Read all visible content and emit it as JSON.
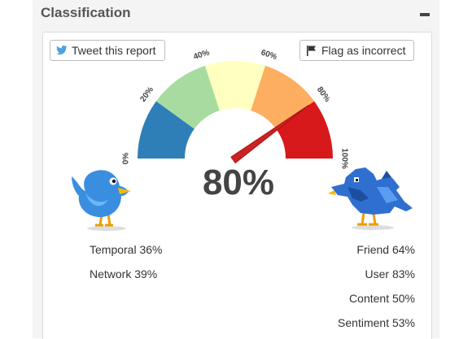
{
  "panel": {
    "title": "Classification",
    "collapse_symbol": "−"
  },
  "buttons": {
    "tweet_label": "Tweet this report",
    "tweet_icon": "twitter-bird-icon",
    "flag_label": "Flag as incorrect",
    "flag_icon": "flag-icon"
  },
  "gauge": {
    "value_percent": 80,
    "display": "80%",
    "tick_labels": [
      "0%",
      "20%",
      "40%",
      "60%",
      "80%",
      "100%"
    ],
    "band_colors": [
      "#2e7fb8",
      "#a8dba0",
      "#ffffbf",
      "#fdae61",
      "#d7191c"
    ],
    "needle_color": "#cc2222"
  },
  "stats_left": [
    {
      "label": "Temporal 36%"
    },
    {
      "label": "Network 39%"
    }
  ],
  "stats_right": [
    {
      "label": "Friend 64%"
    },
    {
      "label": "User 83%"
    },
    {
      "label": "Content 50%"
    },
    {
      "label": "Sentiment 53%"
    }
  ],
  "icons": {
    "left": "human-bird-icon",
    "right": "robot-bird-icon"
  }
}
